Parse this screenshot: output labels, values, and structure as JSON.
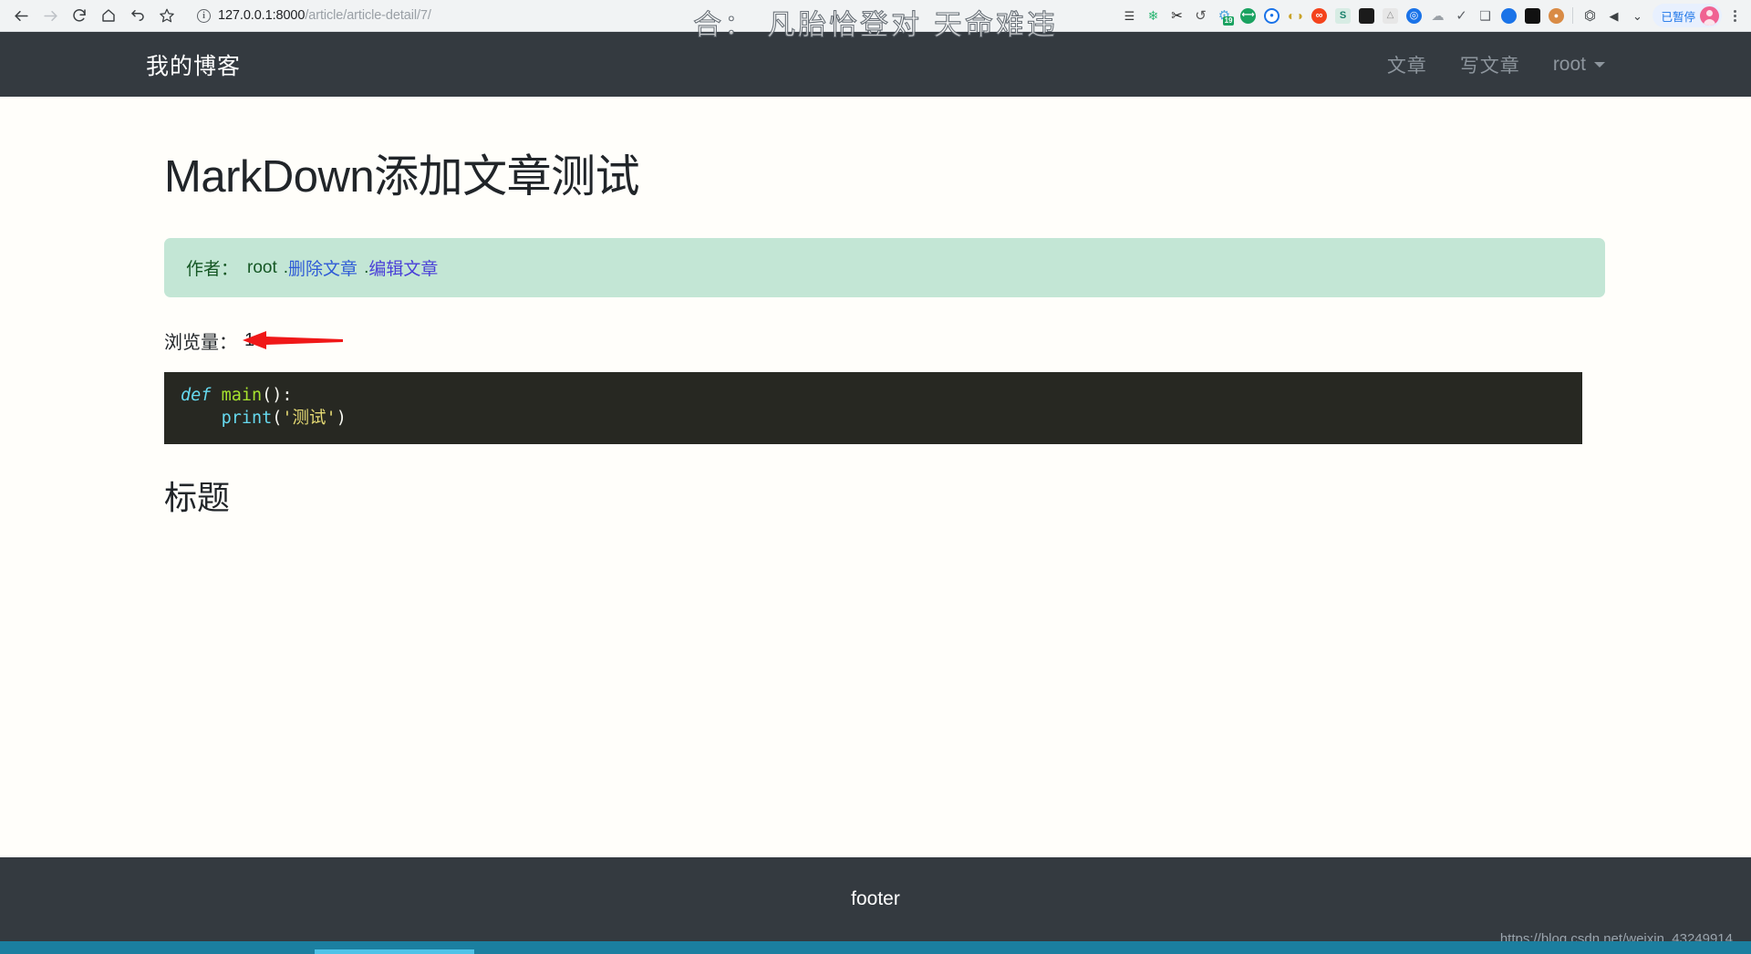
{
  "browser": {
    "nav": {
      "back_icon": "back-arrow-icon",
      "forward_icon": "forward-arrow-icon",
      "reload_icon": "reload-icon",
      "home_icon": "home-icon",
      "undo_icon": "undo-icon",
      "bookmark_icon": "star-icon"
    },
    "omnibox": {
      "info_glyph": "i",
      "url_host": "127.0.0.1:8000",
      "url_path": "/article/article-detail/7/",
      "url_full": "127.0.0.1:8000/article/article-detail/7/"
    },
    "extensions": [
      {
        "name": "baidu-toolbar-icon",
        "glyph": "☰"
      },
      {
        "name": "paw-icon",
        "glyph": "🐾"
      },
      {
        "name": "scissors-icon",
        "glyph": "✂"
      },
      {
        "name": "history-icon",
        "glyph": "↺"
      },
      {
        "name": "gear-icon",
        "glyph": "⚙",
        "badge": "19"
      },
      {
        "name": "green-pill-icon",
        "glyph": "●"
      },
      {
        "name": "blue-record-icon",
        "glyph": "●"
      },
      {
        "name": "glasses-icon",
        "glyph": "👓"
      },
      {
        "name": "infinity-icon",
        "glyph": "∞"
      },
      {
        "name": "s-letter-icon",
        "glyph": "S"
      },
      {
        "name": "dark-panel-icon",
        "glyph": "▬"
      },
      {
        "name": "gray-chart-icon",
        "glyph": "↗"
      },
      {
        "name": "globe-icon",
        "glyph": "⊕"
      },
      {
        "name": "cloud-download-icon",
        "glyph": "☁"
      },
      {
        "name": "checkmark-icon",
        "glyph": "✓"
      },
      {
        "name": "window-stack-icon",
        "glyph": "❐"
      },
      {
        "name": "orange-avatar-icon",
        "glyph": "●"
      },
      {
        "name": "bw-avatar-icon",
        "glyph": "●"
      },
      {
        "name": "monkey-avatar-icon",
        "glyph": "🐵"
      },
      {
        "name": "crop-icon",
        "glyph": "⌧"
      },
      {
        "name": "speaker-icon",
        "glyph": "◀"
      },
      {
        "name": "chevron-double-down-icon",
        "glyph": "»"
      }
    ],
    "paused_pill": {
      "label": "已暂停",
      "avatar": "user-avatar"
    },
    "menu_icon": "kebab-menu-icon"
  },
  "overlay": {
    "caption": "合： 凡胎恰登对 天命难违"
  },
  "navbar": {
    "brand": "我的博客",
    "links": [
      {
        "label": "文章"
      },
      {
        "label": "写文章"
      }
    ],
    "user": "root"
  },
  "article": {
    "title": "MarkDown添加文章测试",
    "author_label": "作者：",
    "author_name": "root",
    "sep": ".",
    "delete_label": "删除文章",
    "edit_label": "编辑文章",
    "views_label": "浏览量：",
    "views_count": "1",
    "code": {
      "line1_kw": "def",
      "line1_fn": "main",
      "line1_punc": "():",
      "line2_call": "print",
      "line2_open": "(",
      "line2_str": "'测试'",
      "line2_close": ")"
    },
    "sub_heading": "标题"
  },
  "footer": {
    "text": "footer",
    "watermark": "https://blog.csdn.net/weixin_43249914"
  },
  "colors": {
    "navbar_bg": "#343a40",
    "alert_bg": "#c3e6d5",
    "alert_text": "#155724",
    "link_blue": "#2f5bd6",
    "code_bg": "#272822",
    "accent_red": "#f01818",
    "taskbar": "#1b7fa0"
  }
}
